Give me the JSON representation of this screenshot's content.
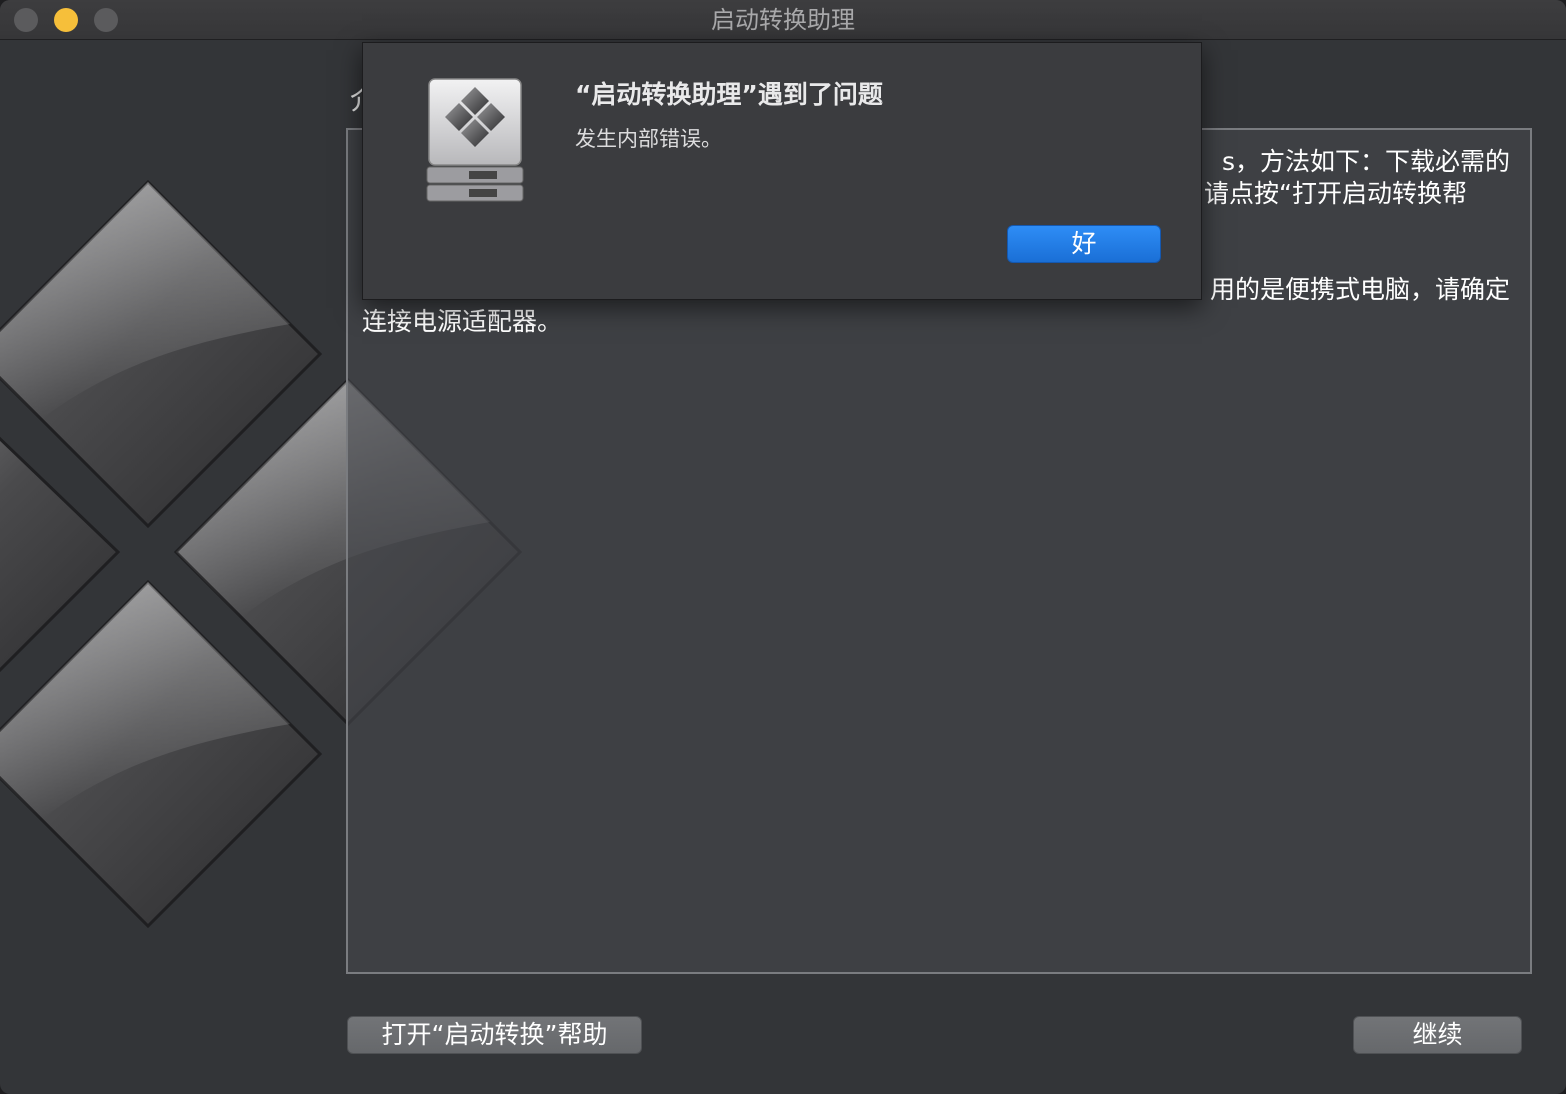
{
  "window": {
    "title": "启动转换助理",
    "accent": "#f6bf3a"
  },
  "panel": {
    "heading_fragment": "介",
    "line1": "s，方法如下：下载必需的",
    "line2": "请点按“打开启动转换帮",
    "line3": "用的是便携式电脑，请确定",
    "line4": "连接电源适配器。"
  },
  "buttons": {
    "help": "打开“启动转换”帮助",
    "continue": "继续"
  },
  "alert": {
    "title": "“启动转换助理”遇到了问题",
    "message": "发生内部错误。",
    "ok": "好",
    "ok_color": "#1a6fd6"
  }
}
